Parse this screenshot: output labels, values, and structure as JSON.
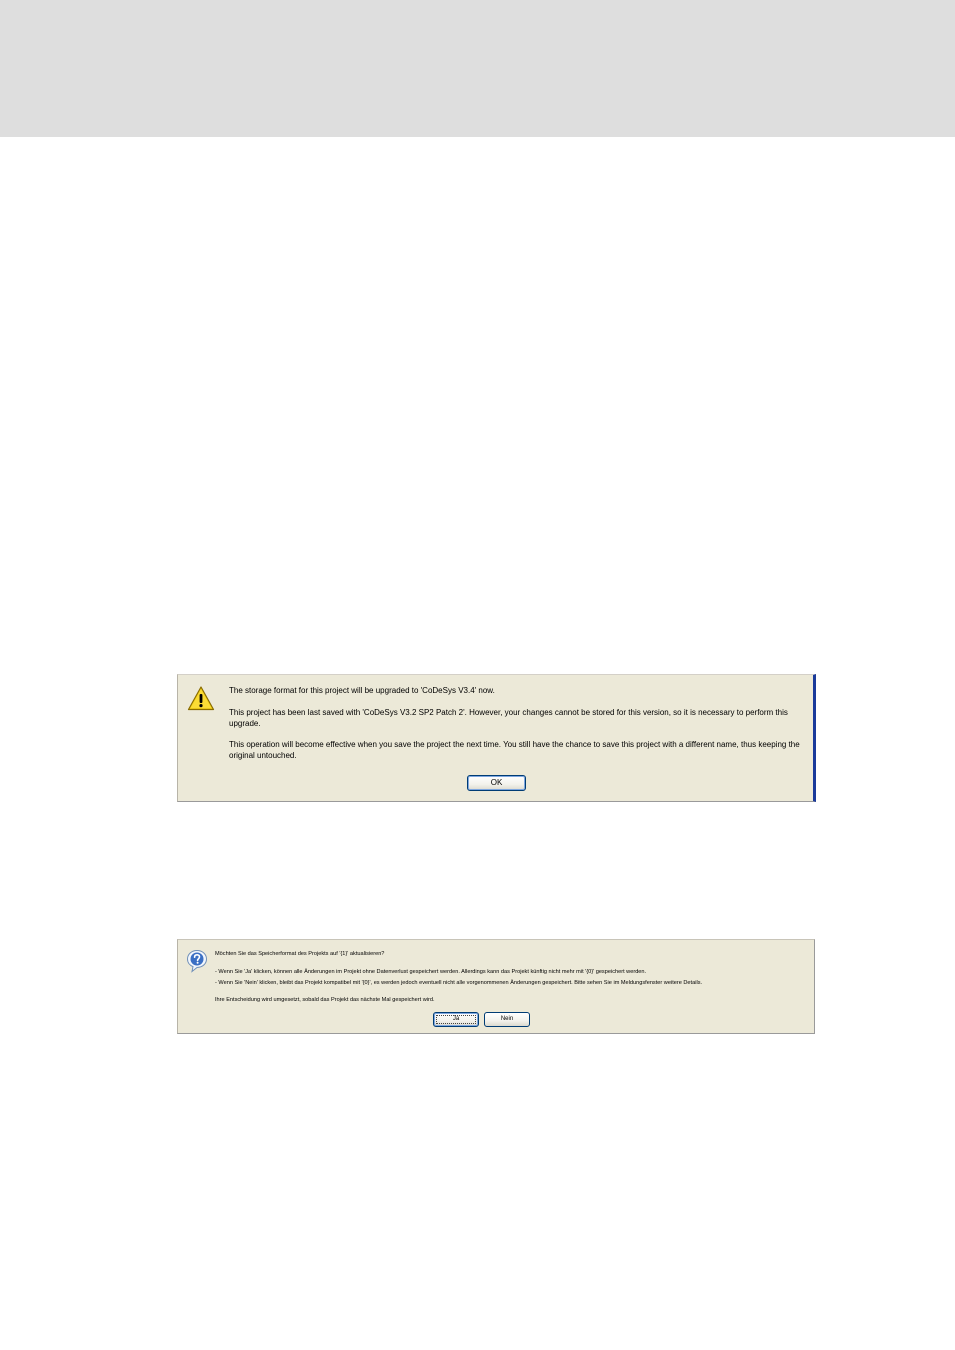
{
  "warning_dialog": {
    "icon": "warning-icon",
    "line1": "The storage format for this project will be upgraded to 'CoDeSys V3.4' now.",
    "line2": "This project has been last saved with 'CoDeSys V3.2 SP2 Patch 2'. However, your changes cannot be stored for this version, so it is necessary to perform this upgrade.",
    "line3": "This operation will become effective when you save the project the next time. You still have the chance to save this project with a different name, thus keeping the original untouched.",
    "ok_label": "OK"
  },
  "question_dialog": {
    "icon": "question-icon",
    "line1": "Möchten Sie das Speicherformat des Projekts auf '{1}' aktualisieren?",
    "line2": "- Wenn Sie 'Ja' klicken, können alle Änderungen im Projekt ohne Datenverlust gespeichert werden. Allerdings kann das Projekt künftig nicht mehr mit '{0}' gespeichert werden.",
    "line3": "- Wenn Sie 'Nein' klicken, bleibt das Projekt kompatibel mit '{0}', es werden jedoch eventuell nicht alle vorgenommenen Änderungen gespeichert. Bitte sehen Sie im Meldungsfenster weitere Details.",
    "line4": "Ihre Entscheidung wird umgesetzt, sobald das Projekt das nächste Mal gespeichert wird.",
    "yes_label": "Ja",
    "no_label": "Nein"
  }
}
